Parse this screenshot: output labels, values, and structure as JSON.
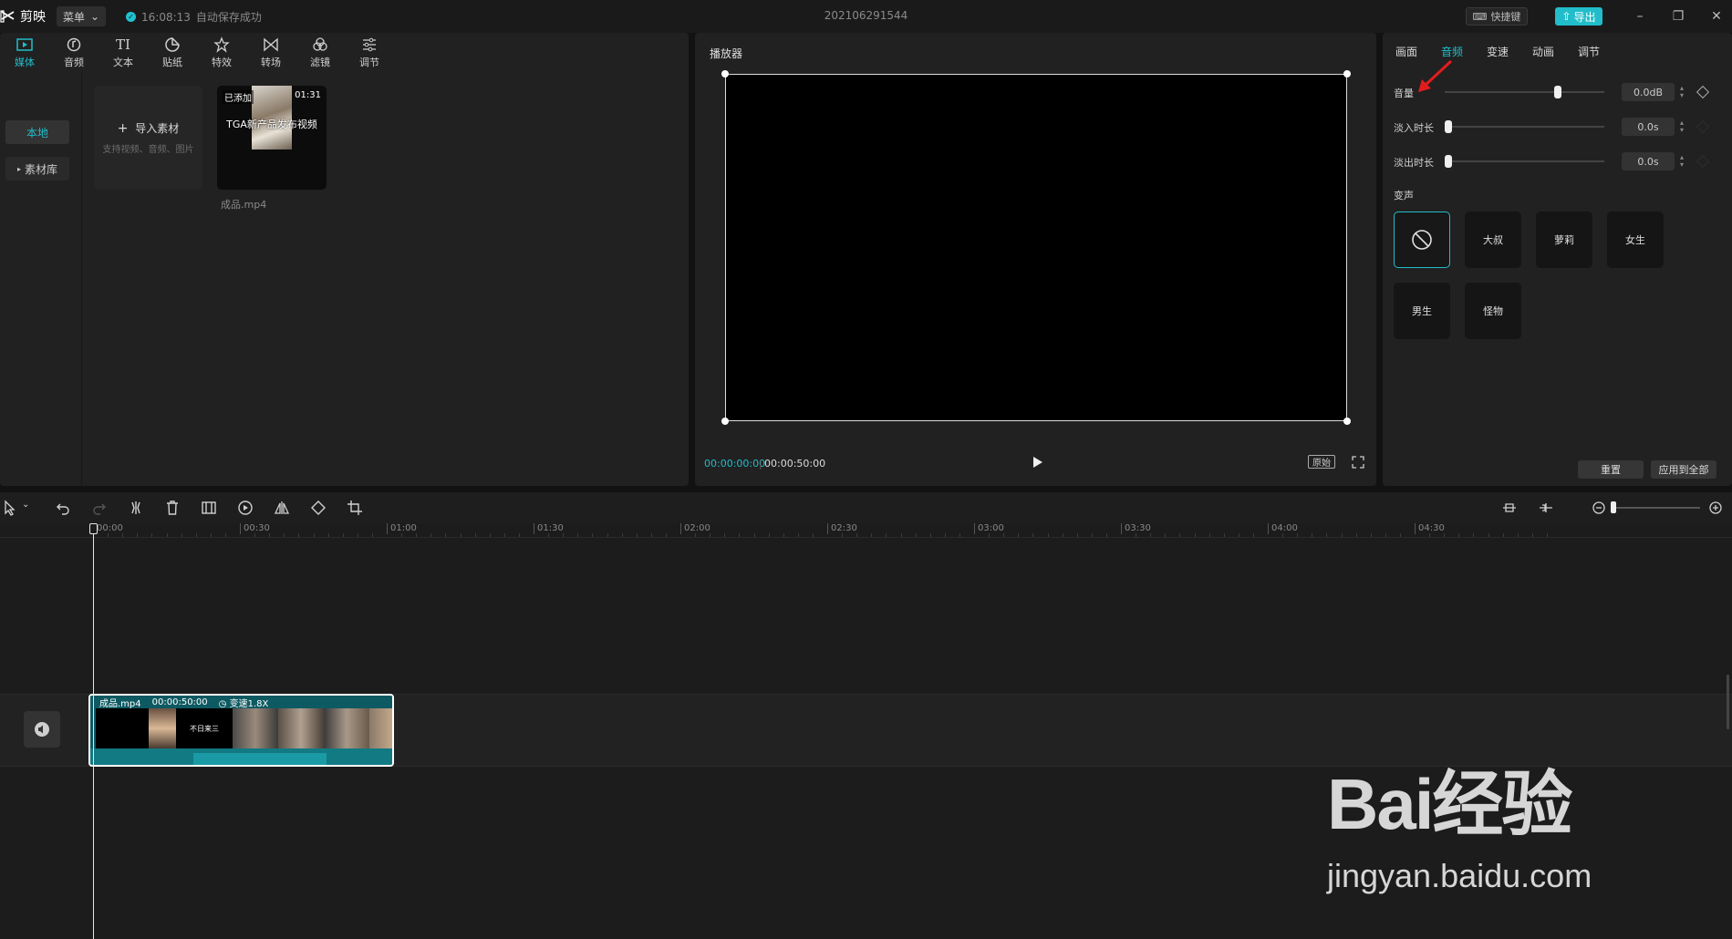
{
  "titlebar": {
    "app_name": "剪映",
    "menu_label": "菜单",
    "autosave_time": "16:08:13",
    "autosave_text": "自动保存成功",
    "project_title": "202106291544",
    "shortcut_label": "快捷键",
    "export_label": "导出"
  },
  "toolbar": {
    "items": [
      {
        "label": "媒体",
        "icon": "media-icon",
        "active": true
      },
      {
        "label": "音频",
        "icon": "audio-icon",
        "active": false
      },
      {
        "label": "文本",
        "icon": "text-icon",
        "active": false
      },
      {
        "label": "贴纸",
        "icon": "sticker-icon",
        "active": false
      },
      {
        "label": "特效",
        "icon": "effects-icon",
        "active": false
      },
      {
        "label": "转场",
        "icon": "transition-icon",
        "active": false
      },
      {
        "label": "滤镜",
        "icon": "filter-icon",
        "active": false
      },
      {
        "label": "调节",
        "icon": "adjust-icon",
        "active": false
      }
    ],
    "text_glyph": "TI"
  },
  "media": {
    "side": {
      "local": "本地",
      "library": "素材库"
    },
    "import": {
      "title": "导入素材",
      "hint": "支持视频、音频、图片"
    },
    "clip": {
      "badge": "已添加",
      "duration": "01:31",
      "caption": "TGA新产品发布视频",
      "name": "成品.mp4"
    }
  },
  "player": {
    "title": "播放器",
    "current_time": "00:00:00:00",
    "total_time": "00:00:50:00",
    "ratio_label": "原始"
  },
  "inspector": {
    "tabs": [
      "画面",
      "音频",
      "变速",
      "动画",
      "调节"
    ],
    "active_tab": "音频",
    "volume": {
      "label": "音量",
      "value": "0.0dB",
      "level": 0.72
    },
    "fade_in": {
      "label": "淡入时长",
      "value": "0.0s",
      "level": 0
    },
    "fade_out": {
      "label": "淡出时长",
      "value": "0.0s",
      "level": 0
    },
    "voice_section": "变声",
    "voices": [
      "大叔",
      "萝莉",
      "女生",
      "男生",
      "怪物"
    ],
    "reset_label": "重置",
    "apply_all_label": "应用到全部"
  },
  "timeline": {
    "ruler": [
      "00:00",
      "00:30",
      "01:00",
      "01:30",
      "02:00",
      "02:30",
      "03:00",
      "03:30",
      "04:00",
      "04:30"
    ],
    "clip": {
      "name": "成品.mp4",
      "duration": "00:00:50:00",
      "speed": "变速1.8X"
    },
    "frame_text": "不日来三"
  },
  "watermark": {
    "brand": "Bai经验",
    "url": "jingyan.baidu.com"
  },
  "colors": {
    "accent": "#22bdca",
    "panel": "#212121",
    "background": "#121212",
    "clip": "#0e5a62"
  }
}
